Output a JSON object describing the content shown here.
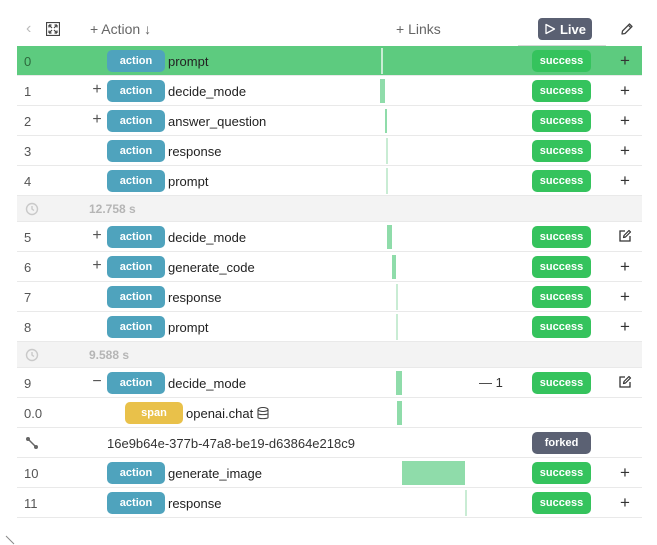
{
  "header": {
    "action_label": "Action",
    "links_label": "Links",
    "live_label": "Live",
    "icons": [
      "chevron-left-icon",
      "expand-icon",
      "plus-icon",
      "sort-down-icon",
      "play-icon",
      "pencil-icon"
    ]
  },
  "rows": [
    {
      "type": "step",
      "index": "0",
      "expander": "",
      "badge": "action",
      "name": "prompt",
      "status": "success",
      "row_action": "+",
      "highlighted": true
    },
    {
      "type": "step",
      "index": "1",
      "expander": "+",
      "badge": "action",
      "name": "decide_mode",
      "status": "success",
      "row_action": "+"
    },
    {
      "type": "step",
      "index": "2",
      "expander": "+",
      "badge": "action",
      "name": "answer_question",
      "status": "success",
      "row_action": "+"
    },
    {
      "type": "step",
      "index": "3",
      "expander": "",
      "badge": "action",
      "name": "response",
      "status": "success",
      "row_action": "+"
    },
    {
      "type": "step",
      "index": "4",
      "expander": "",
      "badge": "action",
      "name": "prompt",
      "status": "success",
      "row_action": "+"
    },
    {
      "type": "gap",
      "time": "12.758 s"
    },
    {
      "type": "step",
      "index": "5",
      "expander": "+",
      "badge": "action",
      "name": "decide_mode",
      "status": "success",
      "row_action": "edit"
    },
    {
      "type": "step",
      "index": "6",
      "expander": "+",
      "badge": "action",
      "name": "generate_code",
      "status": "success",
      "row_action": "+"
    },
    {
      "type": "step",
      "index": "7",
      "expander": "",
      "badge": "action",
      "name": "response",
      "status": "success",
      "row_action": "+"
    },
    {
      "type": "step",
      "index": "8",
      "expander": "",
      "badge": "action",
      "name": "prompt",
      "status": "success",
      "row_action": "+"
    },
    {
      "type": "gap",
      "time": "9.588 s"
    },
    {
      "type": "step",
      "index": "9",
      "expander": "−",
      "badge": "action",
      "name": "decide_mode",
      "links_count": "— 1",
      "status": "success",
      "row_action": "edit"
    },
    {
      "type": "span",
      "index": "0.0",
      "badge": "span",
      "name": "openai.chat"
    },
    {
      "type": "fork",
      "id": "16e9b64e-377b-47a8-be19-d63864e218c9",
      "status": "forked"
    },
    {
      "type": "step",
      "index": "10",
      "expander": "",
      "badge": "action",
      "name": "generate_image",
      "status": "success",
      "row_action": "+"
    },
    {
      "type": "step",
      "index": "11",
      "expander": "",
      "badge": "action",
      "name": "response",
      "status": "success",
      "row_action": "+"
    }
  ],
  "colors": {
    "success": "#35c35d",
    "highlight_row": "#5dcb7f",
    "action_badge": "#4fa3bd",
    "span_badge": "#e9c14a",
    "live_button": "#5a6072",
    "forked": "#5b6173"
  }
}
